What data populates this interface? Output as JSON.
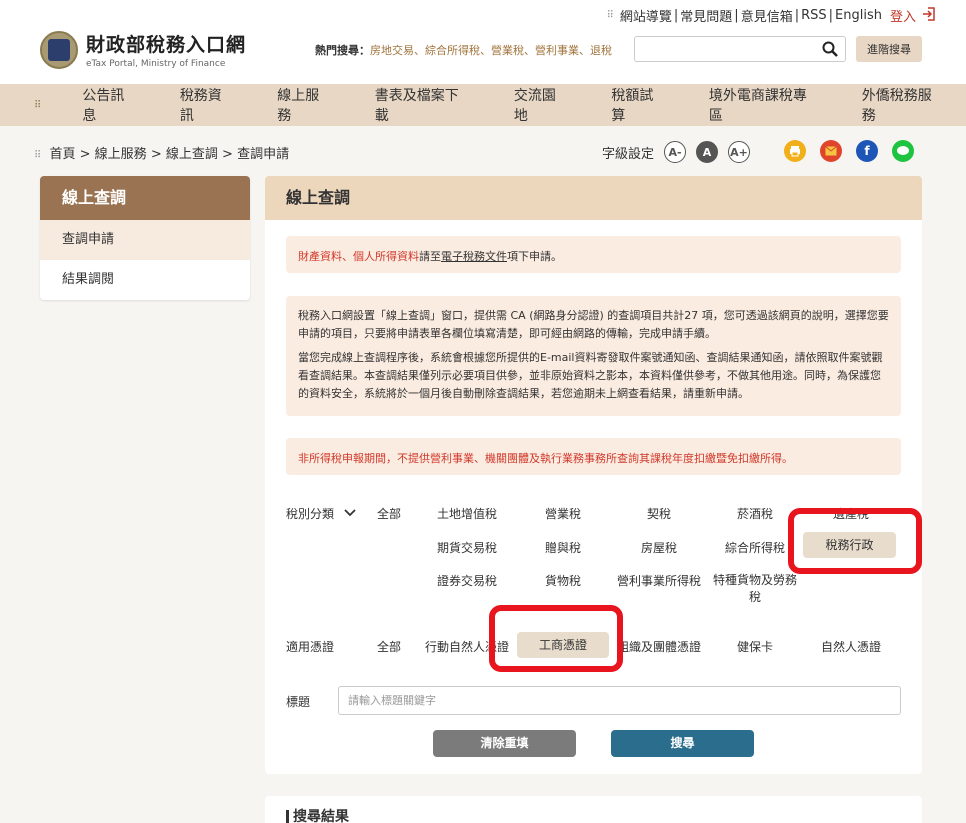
{
  "header": {
    "top_links": [
      "網站導覽",
      "常見問題",
      "意見信箱",
      "RSS",
      "English"
    ],
    "login": "登入",
    "logo_title": "財政部稅務入口網",
    "logo_sub": "eTax Portal, Ministry of Finance",
    "hot_label": "熱門搜尋：",
    "hot_items": "房地交易、綜合所得稅、營業稅、營利事業、退稅",
    "search_placeholder": "",
    "advanced_search": "進階搜尋"
  },
  "nav": {
    "items": [
      "公告訊息",
      "稅務資訊",
      "線上服務",
      "書表及檔案下載",
      "交流園地",
      "稅額試算",
      "境外電商課稅專區",
      "外僑稅務服務"
    ]
  },
  "breadcrumb": {
    "items": [
      "首頁",
      "線上服務",
      "線上查調",
      "查調申請"
    ],
    "separator": ">"
  },
  "font_setting": {
    "label": "字級設定",
    "small": "A-",
    "normal": "A",
    "large": "A+"
  },
  "sidebar": {
    "title": "線上查調",
    "items": [
      "查調申請",
      "結果調閱"
    ]
  },
  "main": {
    "title": "線上查調",
    "note1": {
      "link1": "財產資料",
      "sep": "、",
      "link2": "個人所得資料",
      "text1": "請至",
      "link3": "電子稅務文件",
      "text2": "項下申請。"
    },
    "note2": {
      "p1": "稅務入口網設置「線上查調」窗口，提供需 CA (網路身分認證) 的查調項目共計27 項，您可透過該網頁的說明，選擇您要申請的項目，只要將申請表單各欄位填寫清楚，即可經由網路的傳輸，完成申請手續。",
      "p2": "當您完成線上查調程序後，系統會根據您所提供的E-mail資料寄發取件案號通知函、查調結果通知函，請依照取件案號觀看查調結果。本查調結果僅列示必要項目供參，並非原始資料之影本，本資料僅供參考，不做其他用途。同時，為保護您的資料安全，系統將於一個月後自動刪除查調結果，若您逾期未上網查看結果，請重新申請。"
    },
    "note3": "非所得稅申報期間，不提供營利事業、機關團體及執行業務事務所查詢其課稅年度扣繳暨免扣繳所得。",
    "tax_category": {
      "label": "稅別分類",
      "all": "全部",
      "options": [
        "土地增值稅",
        "營業稅",
        "契稅",
        "菸酒稅",
        "遺產稅",
        "期貨交易稅",
        "贈與稅",
        "房屋稅",
        "綜合所得稅",
        "稅務行政",
        "證券交易稅",
        "貨物稅",
        "營利事業所得稅",
        "特種貨物及勞務稅"
      ],
      "selected": "稅務行政"
    },
    "certificate": {
      "label": "適用憑證",
      "all": "全部",
      "options": [
        "行動自然人憑證",
        "工商憑證",
        "組織及團體憑證",
        "健保卡",
        "自然人憑證"
      ],
      "selected": "工商憑證"
    },
    "title_field": {
      "label": "標題",
      "placeholder": "請輸入標題關鍵字"
    },
    "clear_button": "清除重填",
    "search_button": "搜尋"
  },
  "results": {
    "title": "搜尋結果"
  },
  "colors": {
    "nav_bg": "#e7d7c4",
    "sidebar_head": "#9a7452",
    "main_head": "#ecd6bc",
    "note_bg": "#fbece1",
    "alert_red": "#d0392b",
    "clear_btn": "#7b7b7b",
    "search_btn": "#2b6d8c",
    "highlight": "#e8141e"
  }
}
